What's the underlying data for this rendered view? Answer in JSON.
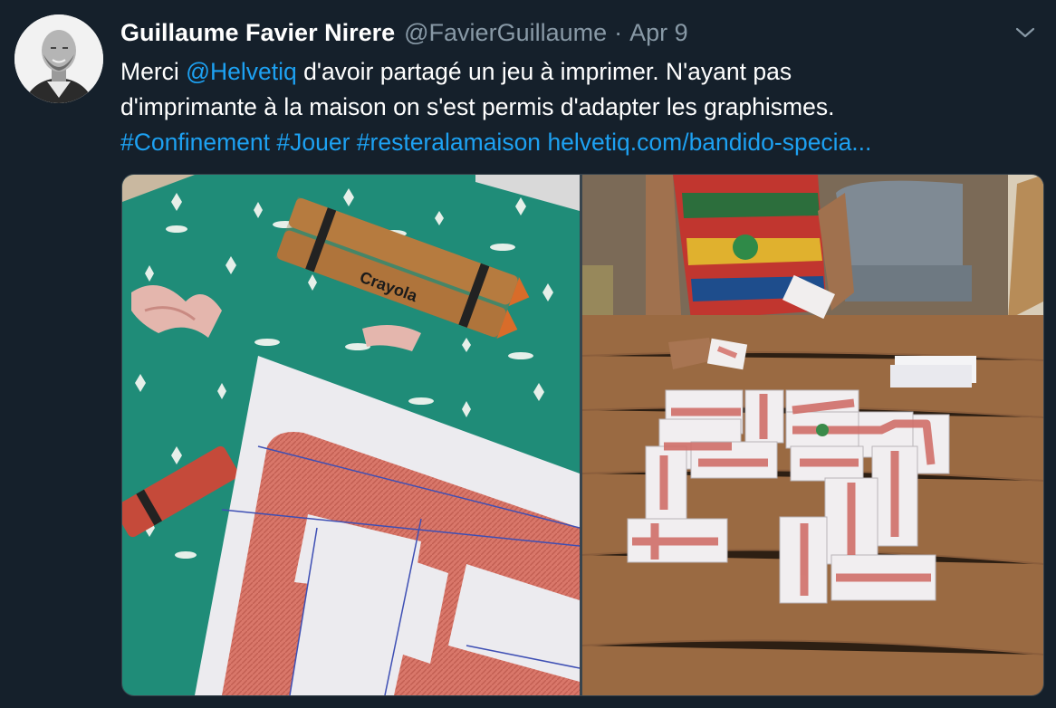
{
  "tweet": {
    "author": {
      "display_name": "Guillaume Favier Nirere",
      "handle": "@FavierGuillaume"
    },
    "separator": "·",
    "date": "Apr 9",
    "text": {
      "line1_prefix": "Merci ",
      "mention": "@Helvetiq",
      "line1_suffix": " d'avoir partagé un jeu à imprimer. N'ayant pas",
      "line2": "d'imprimante à la maison on s'est permis d'adapter les graphismes.",
      "hashtags": [
        "#Confinement",
        "#Jouer",
        "#resteralamaison"
      ],
      "link": "helvetiq.com/bandido-specia..."
    },
    "media": {
      "left_photo_crayon_brand": "Crayola"
    }
  },
  "colors": {
    "background": "#15202b",
    "text_primary": "#ffffff",
    "text_secondary": "#8899a6",
    "link": "#1da1f2",
    "border": "#38444d"
  },
  "icons": {
    "avatar": "profile-photo",
    "caret": "chevron-down-icon"
  }
}
